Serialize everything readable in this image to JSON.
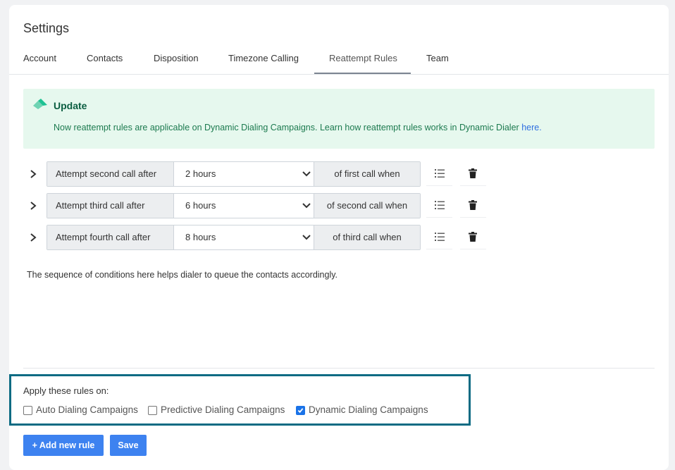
{
  "page": {
    "title": "Settings"
  },
  "tabs": [
    {
      "label": "Account"
    },
    {
      "label": "Contacts"
    },
    {
      "label": "Disposition"
    },
    {
      "label": "Timezone Calling"
    },
    {
      "label": "Reattempt Rules",
      "active": true
    },
    {
      "label": "Team"
    }
  ],
  "banner": {
    "title": "Update",
    "text": "Now reattempt rules are applicable on Dynamic Dialing Campaigns. Learn how reattempt rules works in Dynamic Dialer ",
    "link": "here.",
    "background": "#e6f8ee",
    "text_color": "#1c7a4f"
  },
  "rules": [
    {
      "prefix": "Attempt second call after",
      "value": "2 hours",
      "suffix": "of first call when"
    },
    {
      "prefix": "Attempt third call after",
      "value": "6 hours",
      "suffix": "of second call when"
    },
    {
      "prefix": "Attempt fourth call after",
      "value": "8 hours",
      "suffix": "of third call when"
    }
  ],
  "note": "The sequence of conditions here helps dialer to queue the contacts accordingly.",
  "apply": {
    "label": "Apply these rules on:",
    "options": [
      {
        "label": "Auto Dialing Campaigns",
        "checked": false
      },
      {
        "label": "Predictive Dialing Campaigns",
        "checked": false
      },
      {
        "label": "Dynamic Dialing Campaigns",
        "checked": true
      }
    ],
    "highlight_color": "#0c6b83"
  },
  "buttons": {
    "add_rule": "+ Add new rule",
    "save": "Save",
    "color": "#3d82f0"
  },
  "icons": [
    "chevron-right-icon",
    "chevron-down-icon",
    "list-order-icon",
    "trash-icon",
    "checkmark-icon",
    "update-logo-icon"
  ]
}
